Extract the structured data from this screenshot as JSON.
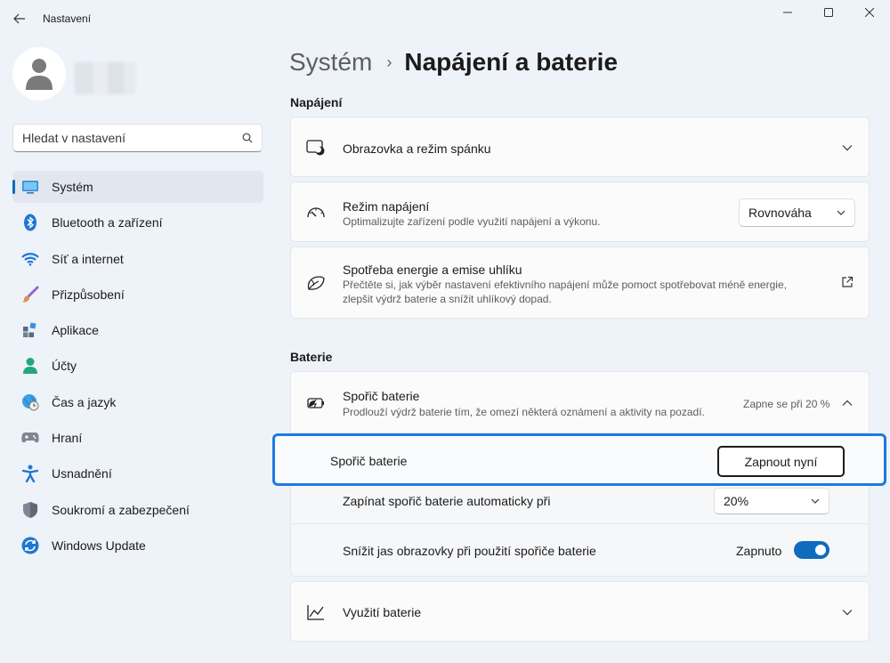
{
  "app_title": "Nastavení",
  "breadcrumb": {
    "parent": "Systém",
    "separator": "›",
    "current": "Napájení a baterie"
  },
  "search": {
    "placeholder": "Hledat v nastavení"
  },
  "sidebar": {
    "items": [
      {
        "label": "Systém",
        "icon": "monitor-icon",
        "active": true
      },
      {
        "label": "Bluetooth a zařízení",
        "icon": "bluetooth-icon"
      },
      {
        "label": "Síť a internet",
        "icon": "wifi-icon"
      },
      {
        "label": "Přizpůsobení",
        "icon": "brush-icon"
      },
      {
        "label": "Aplikace",
        "icon": "apps-icon"
      },
      {
        "label": "Účty",
        "icon": "person-icon"
      },
      {
        "label": "Čas a jazyk",
        "icon": "globe-clock-icon"
      },
      {
        "label": "Hraní",
        "icon": "gamepad-icon"
      },
      {
        "label": "Usnadnění",
        "icon": "accessibility-icon"
      },
      {
        "label": "Soukromí a zabezpečení",
        "icon": "shield-icon"
      },
      {
        "label": "Windows Update",
        "icon": "update-icon"
      }
    ]
  },
  "power": {
    "section_title": "Napájení",
    "screen_sleep": {
      "title": "Obrazovka a režim spánku"
    },
    "power_mode": {
      "title": "Režim napájení",
      "desc": "Optimalizujte zařízení podle využití napájení a výkonu.",
      "value": "Rovnováha"
    },
    "energy": {
      "title": "Spotřeba energie a emise uhlíku",
      "desc1": "Přečtěte si, jak výběr nastavení efektivního napájení může pomoct spotřebovat méně energie,",
      "desc2": "zlepšit výdrž baterie a snížit uhlíkový dopad."
    }
  },
  "battery": {
    "section_title": "Baterie",
    "saver": {
      "title": "Spořič baterie",
      "desc": "Prodlouží výdrž baterie tím, že omezí některá oznámení a aktivity na pozadí.",
      "status": "Zapne se při 20 %"
    },
    "saver_row": {
      "label": "Spořič baterie",
      "button": "Zapnout nyní"
    },
    "auto_row": {
      "label": "Zapínat spořič baterie automaticky při",
      "value": "20%"
    },
    "brightness_row": {
      "label": "Snížit jas obrazovky při použití spořiče baterie",
      "state": "Zapnuto",
      "on": true
    },
    "usage": {
      "title": "Využití baterie"
    }
  },
  "colors": {
    "accent": "#0f6cbd",
    "highlight": "#1e7ae0"
  }
}
